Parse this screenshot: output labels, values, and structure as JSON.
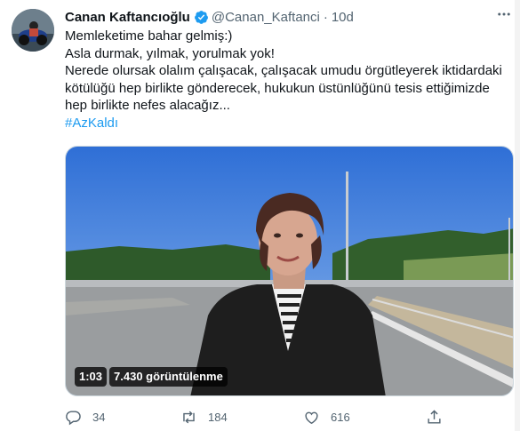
{
  "tweet": {
    "author_name": "Canan Kaftancıoğlu",
    "handle": "@Canan_Kaftanci",
    "separator": "·",
    "time": "10d",
    "lines": [
      "Memleketime bahar gelmiş:)",
      "Asla durmak, yılmak, yorulmak yok!",
      "Nerede olursak olalım çalışacak, çalışacak umudu örgütleyerek iktidardaki",
      "kötülüğü hep birlikte gönderecek, hukukun üstünlüğünü tesis ettiğimizde",
      "hep birlikte nefes alacağız..."
    ],
    "hashtag": "#AzKaldı",
    "video": {
      "duration": "1:03",
      "views": "7.430 görüntülenme"
    },
    "actions": {
      "replies": "34",
      "retweets": "184",
      "likes": "616"
    }
  },
  "icons": {
    "verified": "verified-badge-icon",
    "more": "more-dots-icon",
    "reply": "reply-icon",
    "retweet": "retweet-icon",
    "like": "heart-icon",
    "share": "share-icon"
  },
  "colors": {
    "accent": "#1d9bf0",
    "secondary_text": "#536471",
    "primary_text": "#0f1419"
  }
}
